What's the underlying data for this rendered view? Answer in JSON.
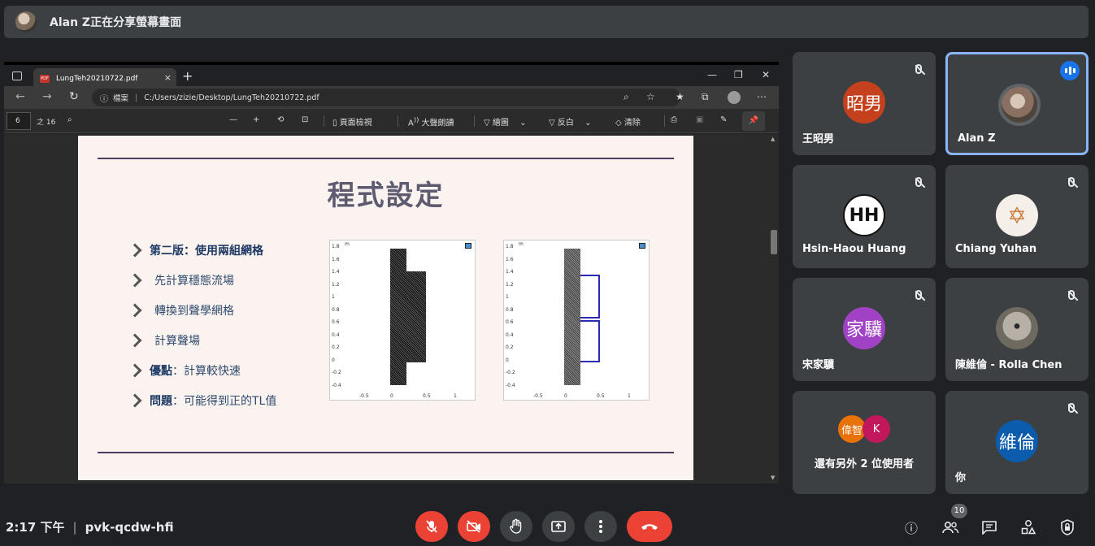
{
  "banner": {
    "text": "Alan Z正在分享螢幕畫面"
  },
  "browser": {
    "tab_title": "LungTeh20210722.pdf",
    "tab_close": "×",
    "new_tab": "+",
    "win_min": "—",
    "win_restore": "❐",
    "win_close": "✕",
    "info_label": "檔案",
    "url": "C:/Users/zizie/Desktop/LungTeh20210722.pdf"
  },
  "pdf_toolbar": {
    "page_number": "6",
    "page_total": "之 16",
    "view_label": "頁面檢視",
    "read_aloud_label": "大聲朗讀",
    "draw_label": "繪圖",
    "highlight_label": "反白",
    "erase_label": "清除"
  },
  "slide": {
    "title": "程式設定",
    "bullets": [
      {
        "bold": "第二版",
        "text": "：使用兩組網格"
      },
      {
        "bold": "",
        "text": "先計算穩態流場"
      },
      {
        "bold": "",
        "text": "轉換到聲學網格"
      },
      {
        "bold": "",
        "text": "計算聲場"
      },
      {
        "bold": "優點",
        "text": "：計算較快速"
      },
      {
        "bold": "問題",
        "text": "：可能得到正的TL值"
      }
    ],
    "plot_y_ticks": [
      "1.8",
      "1.6",
      "1.4",
      "1.2",
      "1",
      "0.8",
      "0.6",
      "0.4",
      "0.2",
      "0",
      "-0.2",
      "-0.4"
    ],
    "plot_x_ticks": [
      "-0.5",
      "0",
      "0.5",
      "1"
    ],
    "plot_unit": "m"
  },
  "participants": [
    {
      "name": "王昭男",
      "initials": "昭男",
      "color": "#c5401c",
      "muted": true
    },
    {
      "name": "Alan Z",
      "initials": "",
      "color": "#6b5e52",
      "muted": false,
      "speaking": true
    },
    {
      "name": "Hsin-Haou Huang",
      "initials": "HH",
      "color": "#ffffff",
      "muted": true
    },
    {
      "name": "Chiang Yuhan",
      "initials": "✡",
      "color": "#f5efe9",
      "muted": true
    },
    {
      "name": "宋家驥",
      "initials": "家驥",
      "color": "#a142c4",
      "muted": true
    },
    {
      "name": "陳維倫 - Rolla Chen",
      "initials": "",
      "color": "#8a857c",
      "muted": true
    },
    {
      "name": "還有另外 2 位使用者",
      "others": [
        {
          "initials": "偉智",
          "color": "#e8710a"
        },
        {
          "initials": "K",
          "color": "#c2185b"
        }
      ]
    },
    {
      "name": "你",
      "initials": "維倫",
      "color": "#0b5cad",
      "muted": true
    }
  ],
  "footer": {
    "time": "2:17 下午",
    "separator": "|",
    "meeting_code": "pvk-qcdw-hfi",
    "people_count": "10"
  }
}
